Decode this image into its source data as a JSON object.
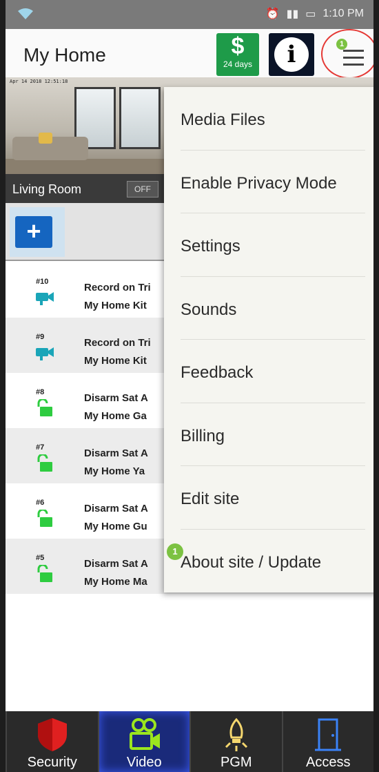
{
  "status_bar": {
    "time": "1:10 PM"
  },
  "header": {
    "title": "My Home",
    "dollar_symbol": "$",
    "subscription_days": "24 days",
    "info_symbol": "i",
    "menu_notification_count": "1"
  },
  "camera": {
    "timestamp": "Apr 14 2018 12:51:18",
    "label": "Living Room",
    "toggle_label": "OFF"
  },
  "add_button": {
    "label": "+"
  },
  "history": [
    {
      "number": "#10",
      "icon": "video-camera-icon",
      "title": "Record on Tri",
      "subtitle": "My Home Kit"
    },
    {
      "number": "#9",
      "icon": "video-camera-icon",
      "title": "Record on Tri",
      "subtitle": "My Home Kit"
    },
    {
      "number": "#8",
      "icon": "unlock-icon",
      "title": "Disarm Sat A",
      "subtitle": "My Home Ga"
    },
    {
      "number": "#7",
      "icon": "unlock-icon",
      "title": "Disarm Sat A",
      "subtitle": "My Home Ya"
    },
    {
      "number": "#6",
      "icon": "unlock-icon",
      "title": "Disarm Sat A",
      "subtitle": "My Home Gu"
    },
    {
      "number": "#5",
      "icon": "unlock-icon",
      "title": "Disarm Sat A",
      "subtitle": "My Home Ma"
    }
  ],
  "menu": {
    "items": [
      {
        "label": "Media Files"
      },
      {
        "label": "Enable Privacy Mode"
      },
      {
        "label": "Settings"
      },
      {
        "label": "Sounds"
      },
      {
        "label": "Feedback"
      },
      {
        "label": "Billing"
      },
      {
        "label": "Edit site"
      },
      {
        "label": "About site / Update",
        "badge": "1"
      }
    ]
  },
  "bottom_nav": {
    "items": [
      {
        "label": "Security",
        "icon": "shield-icon"
      },
      {
        "label": "Video",
        "icon": "video-camera-icon",
        "active": true
      },
      {
        "label": "PGM",
        "icon": "bulb-icon"
      },
      {
        "label": "Access",
        "icon": "door-icon"
      }
    ]
  },
  "colors": {
    "accent_green": "#1e9b49",
    "badge_green": "#7cc242",
    "menu_highlight_ring": "#e53935",
    "add_button_blue": "#1565c0",
    "video_icon_teal": "#1aa5b8",
    "unlock_icon_green": "#2ecc40",
    "security_red": "#e02020",
    "nav_active_blue": "#1a2a7a"
  }
}
